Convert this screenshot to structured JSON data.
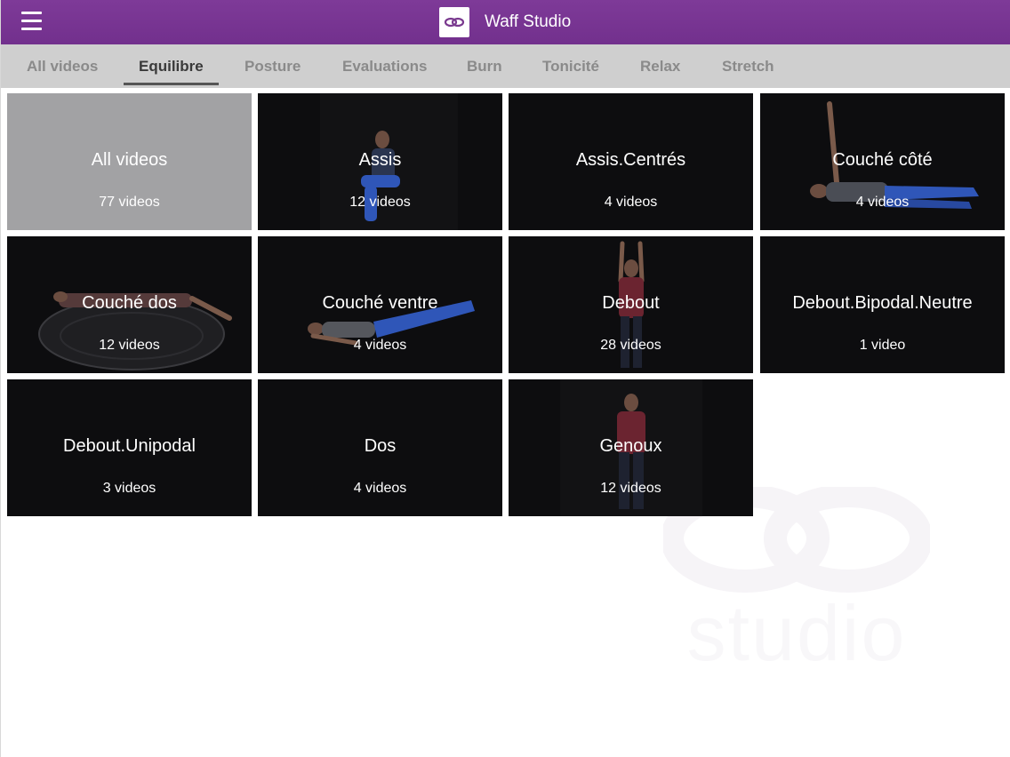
{
  "header": {
    "title": "Waff Studio",
    "menu_icon": "hamburger-menu-icon",
    "logo_icon": "waff-logo-icon",
    "accent_color": "#7b3795"
  },
  "tabs": [
    {
      "label": "All videos",
      "active": false
    },
    {
      "label": "Equilibre",
      "active": true
    },
    {
      "label": "Posture",
      "active": false
    },
    {
      "label": "Evaluations",
      "active": false
    },
    {
      "label": "Burn",
      "active": false
    },
    {
      "label": "Tonicité",
      "active": false
    },
    {
      "label": "Relax",
      "active": false
    },
    {
      "label": "Stretch",
      "active": false
    }
  ],
  "categories": [
    {
      "title": "All videos",
      "count": "77 videos"
    },
    {
      "title": "Assis",
      "count": "12 videos"
    },
    {
      "title": "Assis.Centrés",
      "count": "4 videos"
    },
    {
      "title": "Couché côté",
      "count": "4 videos"
    },
    {
      "title": "Couché dos",
      "count": "12 videos"
    },
    {
      "title": "Couché ventre",
      "count": "4 videos"
    },
    {
      "title": "Debout",
      "count": "28 videos"
    },
    {
      "title": "Debout.Bipodal.Neutre",
      "count": "1 video"
    },
    {
      "title": "Debout.Unipodal",
      "count": "3 videos"
    },
    {
      "title": "Dos",
      "count": "4 videos"
    },
    {
      "title": "Genoux",
      "count": "12 videos"
    }
  ],
  "watermark": {
    "text": "studio",
    "icon": "waff-logo-watermark-icon"
  }
}
